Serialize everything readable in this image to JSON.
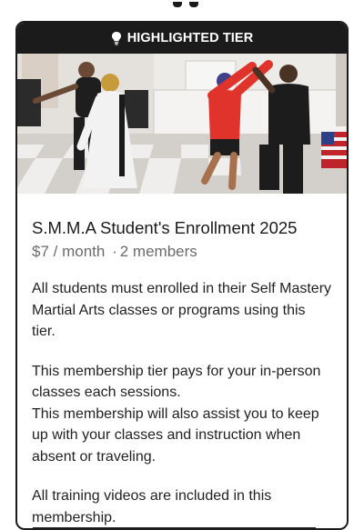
{
  "card": {
    "badge_label": "HIGHLIGHTED TIER",
    "badge_icon": "lightbulb-icon",
    "image_alt": "Martial arts class practicing in studio",
    "title": "S.M.M.A Student's Enrollment 2025",
    "price": "$7 / month",
    "separator": "·",
    "members": "2 members",
    "paragraphs": [
      "All students must enrolled in their Self Mastery Martial Arts classes or programs using this tier.",
      "This membership tier pays for your in-person classes each sessions.",
      "This membership will also assist you to keep up with your classes and instruction when absent or traveling.",
      "All training videos are included in this membership."
    ]
  },
  "colors": {
    "banner_bg": "#1b1b1b",
    "title": "#1a1a1a",
    "meta": "#6b6b6b"
  }
}
